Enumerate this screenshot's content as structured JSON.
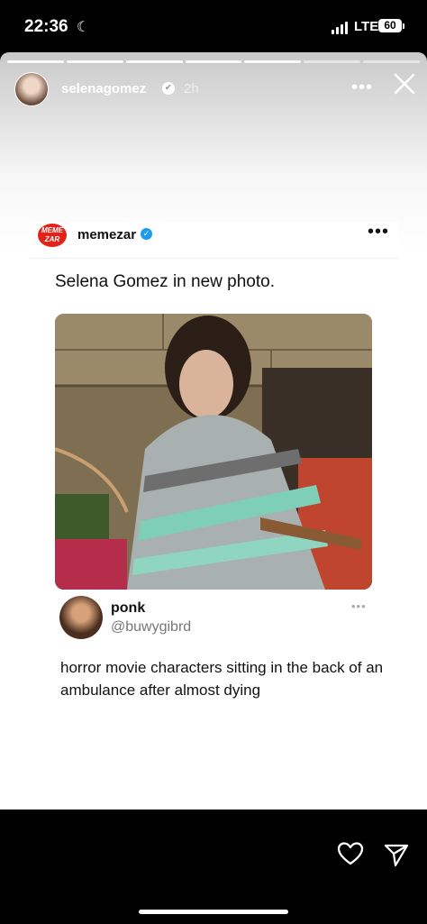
{
  "status_bar": {
    "time": "22:36",
    "network": "LTE",
    "battery": "60"
  },
  "story": {
    "username": "selenagomez",
    "time_ago": "2h",
    "progress_segments": 7,
    "progress_active": 5
  },
  "post": {
    "account": "memezar",
    "logo_text": "MEME ZAR",
    "text": "Selena Gomez in new photo."
  },
  "quote": {
    "name": "ponk",
    "handle": "@buwygibrd",
    "text": "horror movie characters sitting in the back of an ambulance after almost dying"
  },
  "icons": {
    "heart": "heart-icon",
    "send": "send-icon",
    "close": "close-icon",
    "more": "more-icon"
  },
  "colors": {
    "meme_logo": "#e2231a",
    "verified_blue": "#1d9bf0"
  }
}
